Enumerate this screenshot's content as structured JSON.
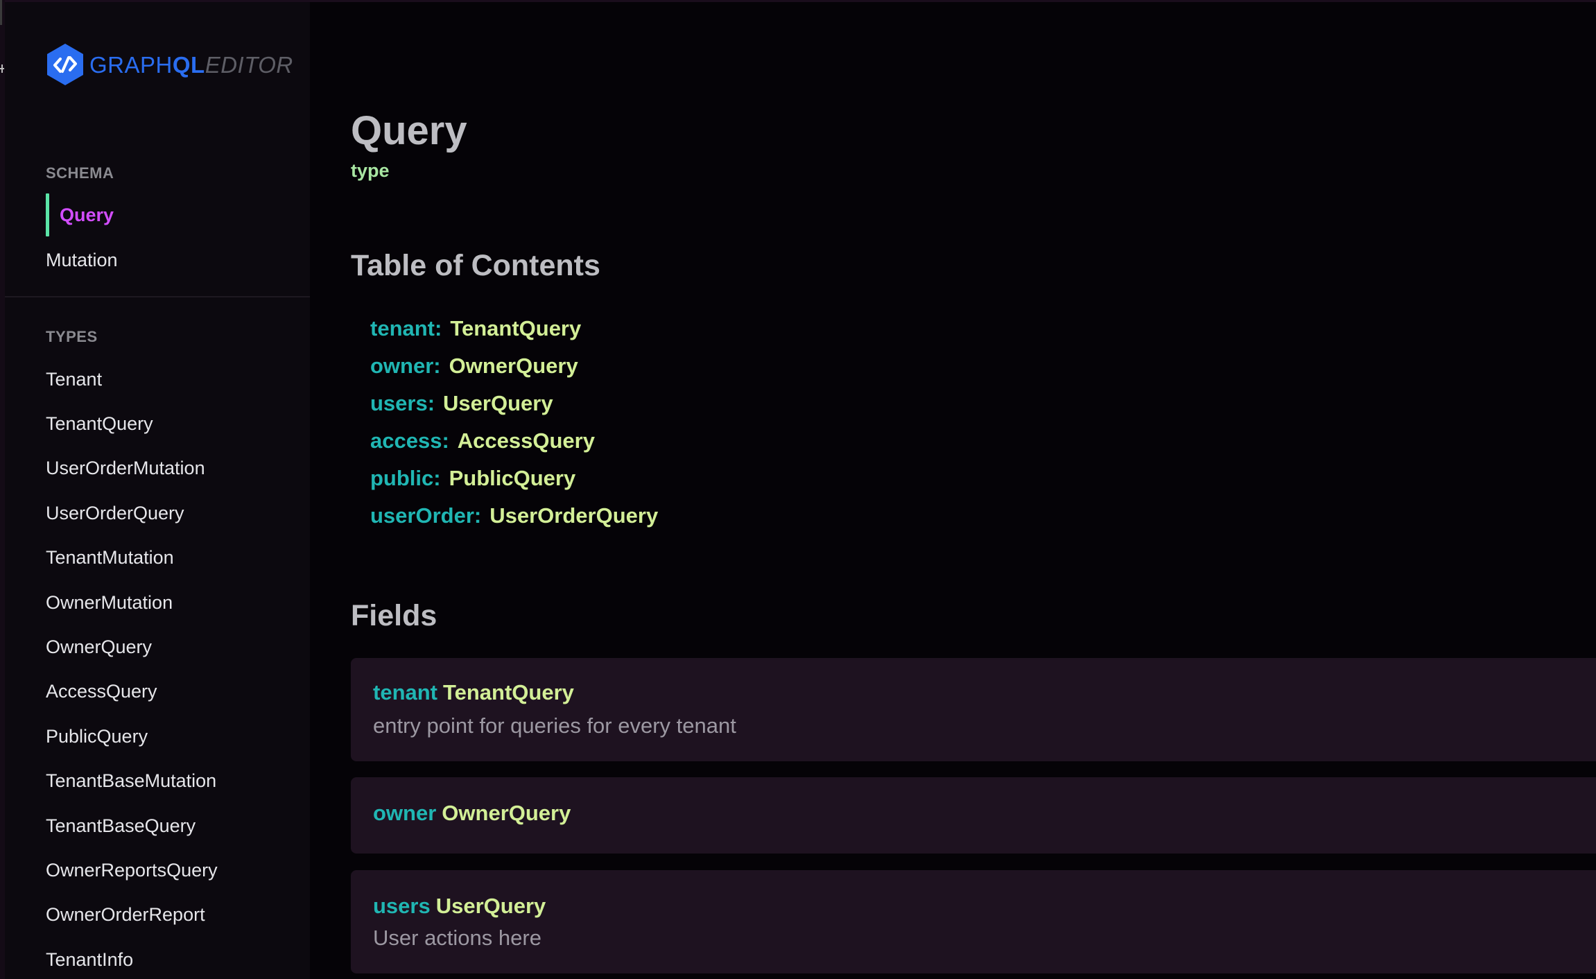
{
  "logo": {
    "graph": "GRAPH",
    "ql": "QL",
    "editor": "EDITOR"
  },
  "sidebar": {
    "schema_label": "SCHEMA",
    "schema_items": [
      {
        "label": "Query",
        "active": true
      },
      {
        "label": "Mutation",
        "active": false
      }
    ],
    "types_label": "TYPES",
    "types": [
      "Tenant",
      "TenantQuery",
      "UserOrderMutation",
      "UserOrderQuery",
      "TenantMutation",
      "OwnerMutation",
      "OwnerQuery",
      "AccessQuery",
      "PublicQuery",
      "TenantBaseMutation",
      "TenantBaseQuery",
      "OwnerReportsQuery",
      "OwnerOrderReport",
      "TenantInfo"
    ]
  },
  "main": {
    "title": "Query",
    "subtitle": "type",
    "toc_heading": "Table of Contents",
    "toc": [
      {
        "key": "tenant:",
        "type": "TenantQuery"
      },
      {
        "key": "owner:",
        "type": "OwnerQuery"
      },
      {
        "key": "users:",
        "type": "UserQuery"
      },
      {
        "key": "access:",
        "type": "AccessQuery"
      },
      {
        "key": "public:",
        "type": "PublicQuery"
      },
      {
        "key": "userOrder:",
        "type": "UserOrderQuery"
      }
    ],
    "fields_heading": "Fields",
    "fields": [
      {
        "name": "tenant",
        "type": "TenantQuery",
        "description": "entry point for queries for every tenant"
      },
      {
        "name": "owner",
        "type": "OwnerQuery",
        "description": ""
      },
      {
        "name": "users",
        "type": "UserQuery",
        "description": "User actions here"
      }
    ]
  },
  "colors": {
    "background": "#050307",
    "sidebar": "#0c090f",
    "active_item": "#d24dff",
    "active_bar": "#5be4a7",
    "field_key": "#20b6b3",
    "field_type": "#d3ef97",
    "card": "#1e1220",
    "brand": "#2a6df0"
  }
}
